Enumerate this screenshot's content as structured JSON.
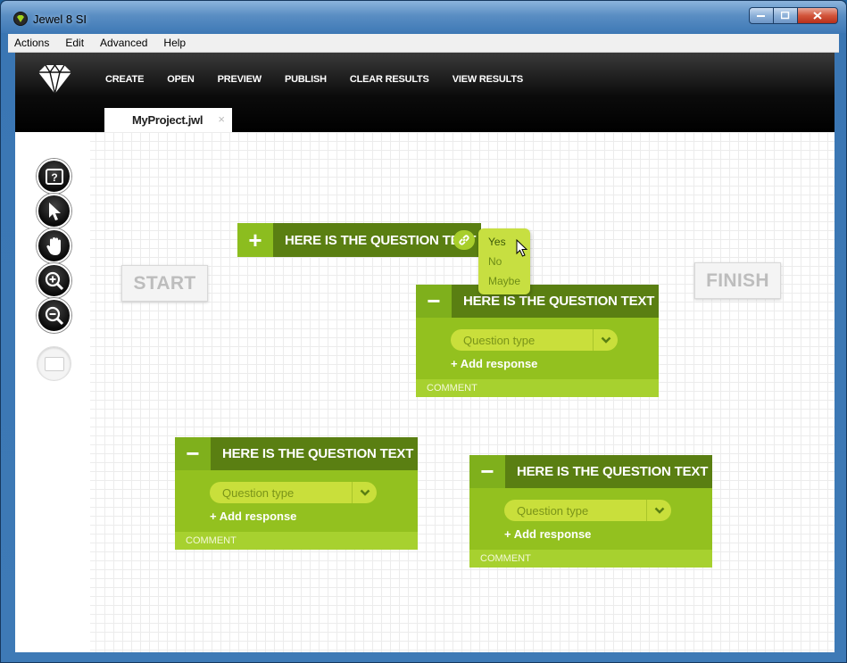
{
  "window": {
    "title": "Jewel 8 SI"
  },
  "menu": [
    "Actions",
    "Edit",
    "Advanced",
    "Help"
  ],
  "nav": [
    "CREATE",
    "OPEN",
    "PREVIEW",
    "PUBLISH",
    "CLEAR RESULTS",
    "VIEW RESULTS"
  ],
  "tab": {
    "label": "MyProject.jwl",
    "close": "×"
  },
  "start_label": "START",
  "finish_label": "FINISH",
  "collapsed_question": {
    "toggle": "+",
    "title": "HERE IS THE QUESTION TEXT"
  },
  "popup_options": [
    "Yes",
    "No",
    "Maybe"
  ],
  "questions": [
    {
      "toggle": "−",
      "title": "HERE IS THE QUESTION TEXT",
      "type_placeholder": "Question type",
      "add_response": "+ Add response",
      "comment": "COMMENT"
    },
    {
      "toggle": "−",
      "title": "HERE IS THE QUESTION TEXT",
      "type_placeholder": "Question type",
      "add_response": "+ Add response",
      "comment": "COMMENT"
    },
    {
      "toggle": "−",
      "title": "HERE IS THE QUESTION TEXT",
      "type_placeholder": "Question type",
      "add_response": "+ Add response",
      "comment": "COMMENT"
    }
  ],
  "tools": [
    "help-icon",
    "select-arrow-icon",
    "hand-pan-icon",
    "zoom-in-icon",
    "zoom-out-icon",
    "shape-icon"
  ],
  "colors": {
    "accent_green": "#93c11f",
    "title_green": "#5a7f12",
    "toolbar_black": "#000000"
  }
}
